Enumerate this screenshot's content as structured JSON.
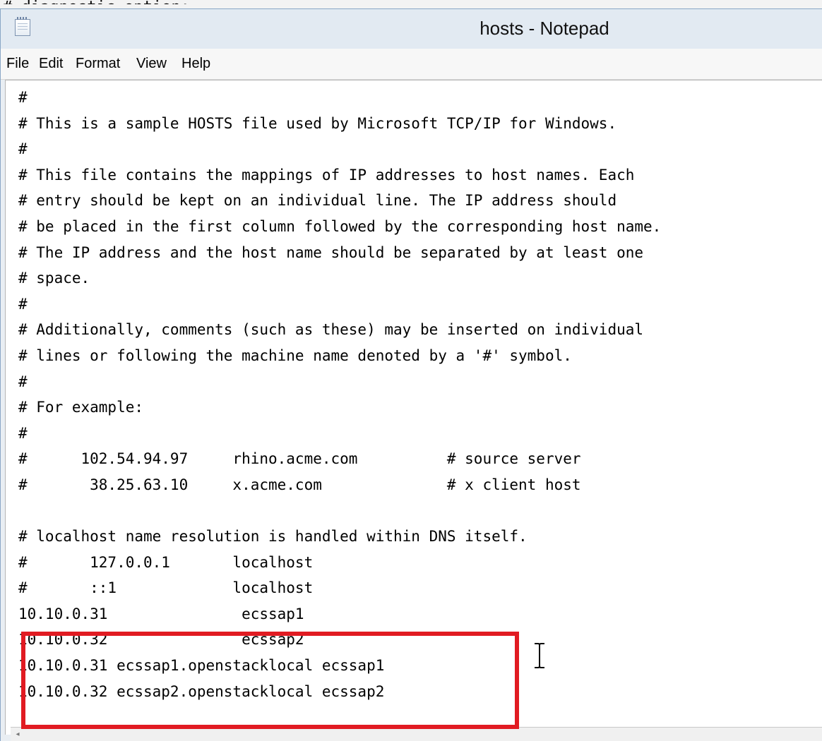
{
  "window": {
    "title": "hosts - Notepad",
    "cropped_line_above": "# diagnostic option: ..."
  },
  "menu": {
    "items": [
      {
        "label": "File"
      },
      {
        "label": "Edit"
      },
      {
        "label": "Format"
      },
      {
        "label": "View"
      },
      {
        "label": "Help"
      }
    ]
  },
  "editor": {
    "lines": [
      "#",
      "# This is a sample HOSTS file used by Microsoft TCP/IP for Windows.",
      "#",
      "# This file contains the mappings of IP addresses to host names. Each",
      "# entry should be kept on an individual line. The IP address should",
      "# be placed in the first column followed by the corresponding host name.",
      "# The IP address and the host name should be separated by at least one",
      "# space.",
      "#",
      "# Additionally, comments (such as these) may be inserted on individual",
      "# lines or following the machine name denoted by a '#' symbol.",
      "#",
      "# For example:",
      "#",
      "#      102.54.94.97     rhino.acme.com          # source server",
      "#       38.25.63.10     x.acme.com              # x client host",
      "",
      "# localhost name resolution is handled within DNS itself.",
      "#       127.0.0.1       localhost",
      "#       ::1             localhost",
      "10.10.0.31               ecssap1",
      "10.10.0.32               ecssap2",
      "10.10.0.31 ecssap1.openstacklocal ecssap1",
      "10.10.0.32 ecssap2.openstacklocal ecssap2"
    ]
  },
  "annotation": {
    "color": "#e11b22"
  },
  "icons": {
    "app": "notepad-icon",
    "cursor": "ibeam-cursor-icon",
    "scroll": "scroll-left-arrow-icon"
  }
}
